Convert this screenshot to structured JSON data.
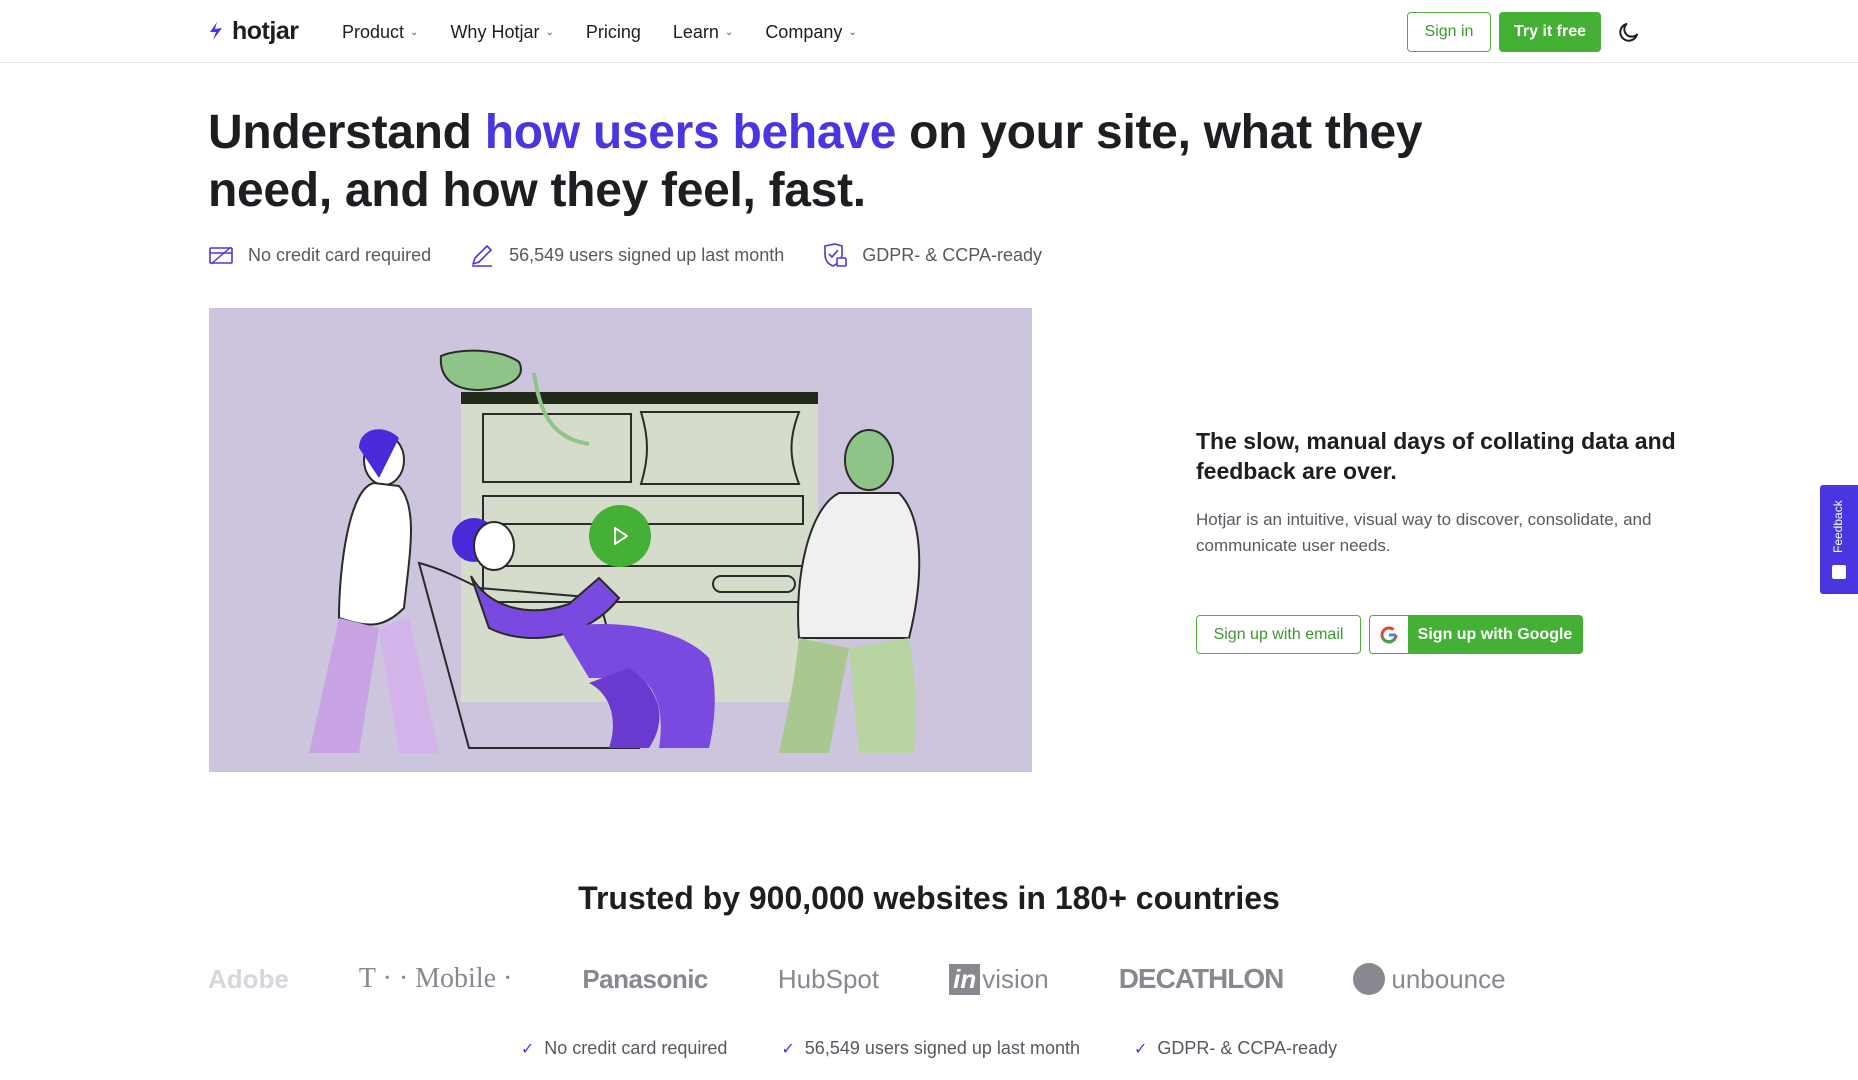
{
  "nav": {
    "logo_text": "hotjar",
    "items": [
      {
        "label": "Product",
        "has_caret": true
      },
      {
        "label": "Why Hotjar",
        "has_caret": true
      },
      {
        "label": "Pricing",
        "has_caret": false
      },
      {
        "label": "Learn",
        "has_caret": true
      },
      {
        "label": "Company",
        "has_caret": true
      }
    ],
    "caret": "⌄",
    "signin_label": "Sign in",
    "try_label": "Try it free",
    "theme_icon": "moon-icon"
  },
  "hero": {
    "title_part1": "Understand ",
    "title_accent": "how users behave",
    "title_part2": " on your site, what they need, and how they feel, fast.",
    "features": [
      {
        "icon": "credit-card-icon",
        "label": "No credit card required"
      },
      {
        "icon": "pencil-icon",
        "label": "56,549 users signed up last month"
      },
      {
        "icon": "shield-lock-icon",
        "label": "GDPR- & CCPA-ready"
      }
    ]
  },
  "video": {
    "play_icon": "play-icon"
  },
  "pitch": {
    "title": "The slow, manual days of collating data and feedback are over.",
    "text": "Hotjar is an intuitive, visual way to discover, consolidate, and communicate user needs.",
    "email_button": "Sign up with email",
    "google_button": "Sign up with Google"
  },
  "feedback_tab": {
    "label": "Feedback"
  },
  "trust": {
    "title": "Trusted by 900,000 websites in 180+ countries",
    "brands": [
      "Adobe",
      "T · · Mobile ·",
      "Panasonic",
      "HubSpot",
      "in",
      "vision",
      "DECATHLON",
      "unbounce"
    ],
    "checks": [
      "No credit card required",
      "56,549 users signed up last month",
      "GDPR- & CCPA-ready"
    ],
    "check_icon": "✓"
  },
  "colors": {
    "brand_green": "#44b035",
    "accent_purple": "#4a36e0",
    "video_bg": "#cdc5dd"
  }
}
